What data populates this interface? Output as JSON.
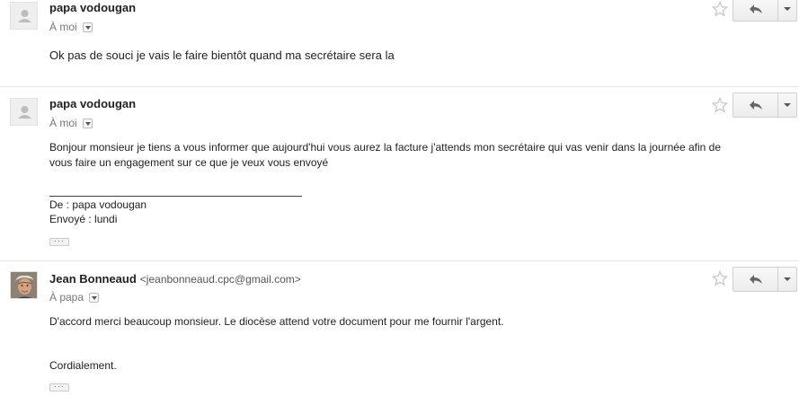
{
  "messages": [
    {
      "sender": "papa vodougan",
      "sender_email": "",
      "recipient": "À moi",
      "body": "Ok pas de souci je vais le faire bientôt quand ma secrétaire sera la",
      "avatar": "default-avatar-icon"
    },
    {
      "sender": "papa vodougan",
      "sender_email": "",
      "recipient": "À moi",
      "body_line1": "Bonjour monsieur je tiens a vous informer que aujourd'hui vous aurez la facture j'attends mon secrétaire qui vas venir dans la journée afin de",
      "body_line2": "vous faire un engagement sur ce que je veux vous envoyé",
      "quote_from": "De : papa vodougan",
      "quote_sent": "Envoyé : lundi",
      "avatar": "default-avatar-icon"
    },
    {
      "sender": "Jean Bonneaud",
      "sender_email": "<jeanbonneaud.cpc@gmail.com>",
      "recipient": "À papa",
      "body": "D'accord merci beaucoup monsieur. Le diocèse attend votre document pour me fournir l'argent.",
      "closing": "Cordialement.",
      "avatar": "profile-photo"
    }
  ],
  "ellipsis_label": "···",
  "colors": {
    "divider": "#e5e5e5",
    "icon_gray": "#888888",
    "star": "#c6c6c6"
  }
}
